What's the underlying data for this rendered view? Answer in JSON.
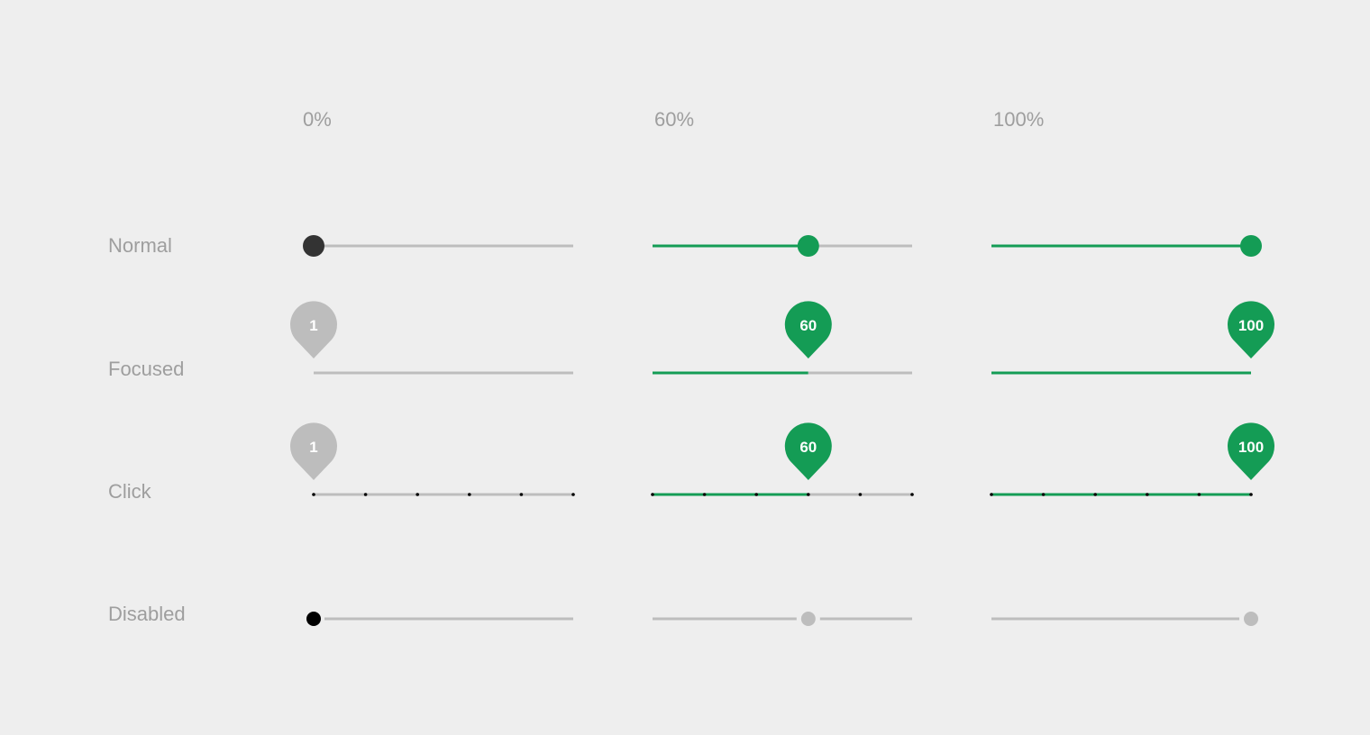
{
  "columns": [
    {
      "header": "0%",
      "value": 0
    },
    {
      "header": "60%",
      "value": 60
    },
    {
      "header": "100%",
      "value": 100
    }
  ],
  "rows": [
    {
      "label": "Normal",
      "state": "normal"
    },
    {
      "label": "Focused",
      "state": "focused"
    },
    {
      "label": "Click",
      "state": "click"
    },
    {
      "label": "Disabled",
      "state": "disabled"
    }
  ],
  "bubble_labels": [
    "1",
    "60",
    "100"
  ],
  "colors": {
    "background": "#eeeeee",
    "accent": "#149c55",
    "track_inactive": "#bdbdbd",
    "thumb_off": "#333333",
    "thumb_disabled_off": "#000000",
    "thumb_disabled": "#bdbdbd",
    "tick": "#000000",
    "label_text": "#9e9e9e",
    "bubble_text": "#ffffff"
  },
  "tick_count": 6
}
